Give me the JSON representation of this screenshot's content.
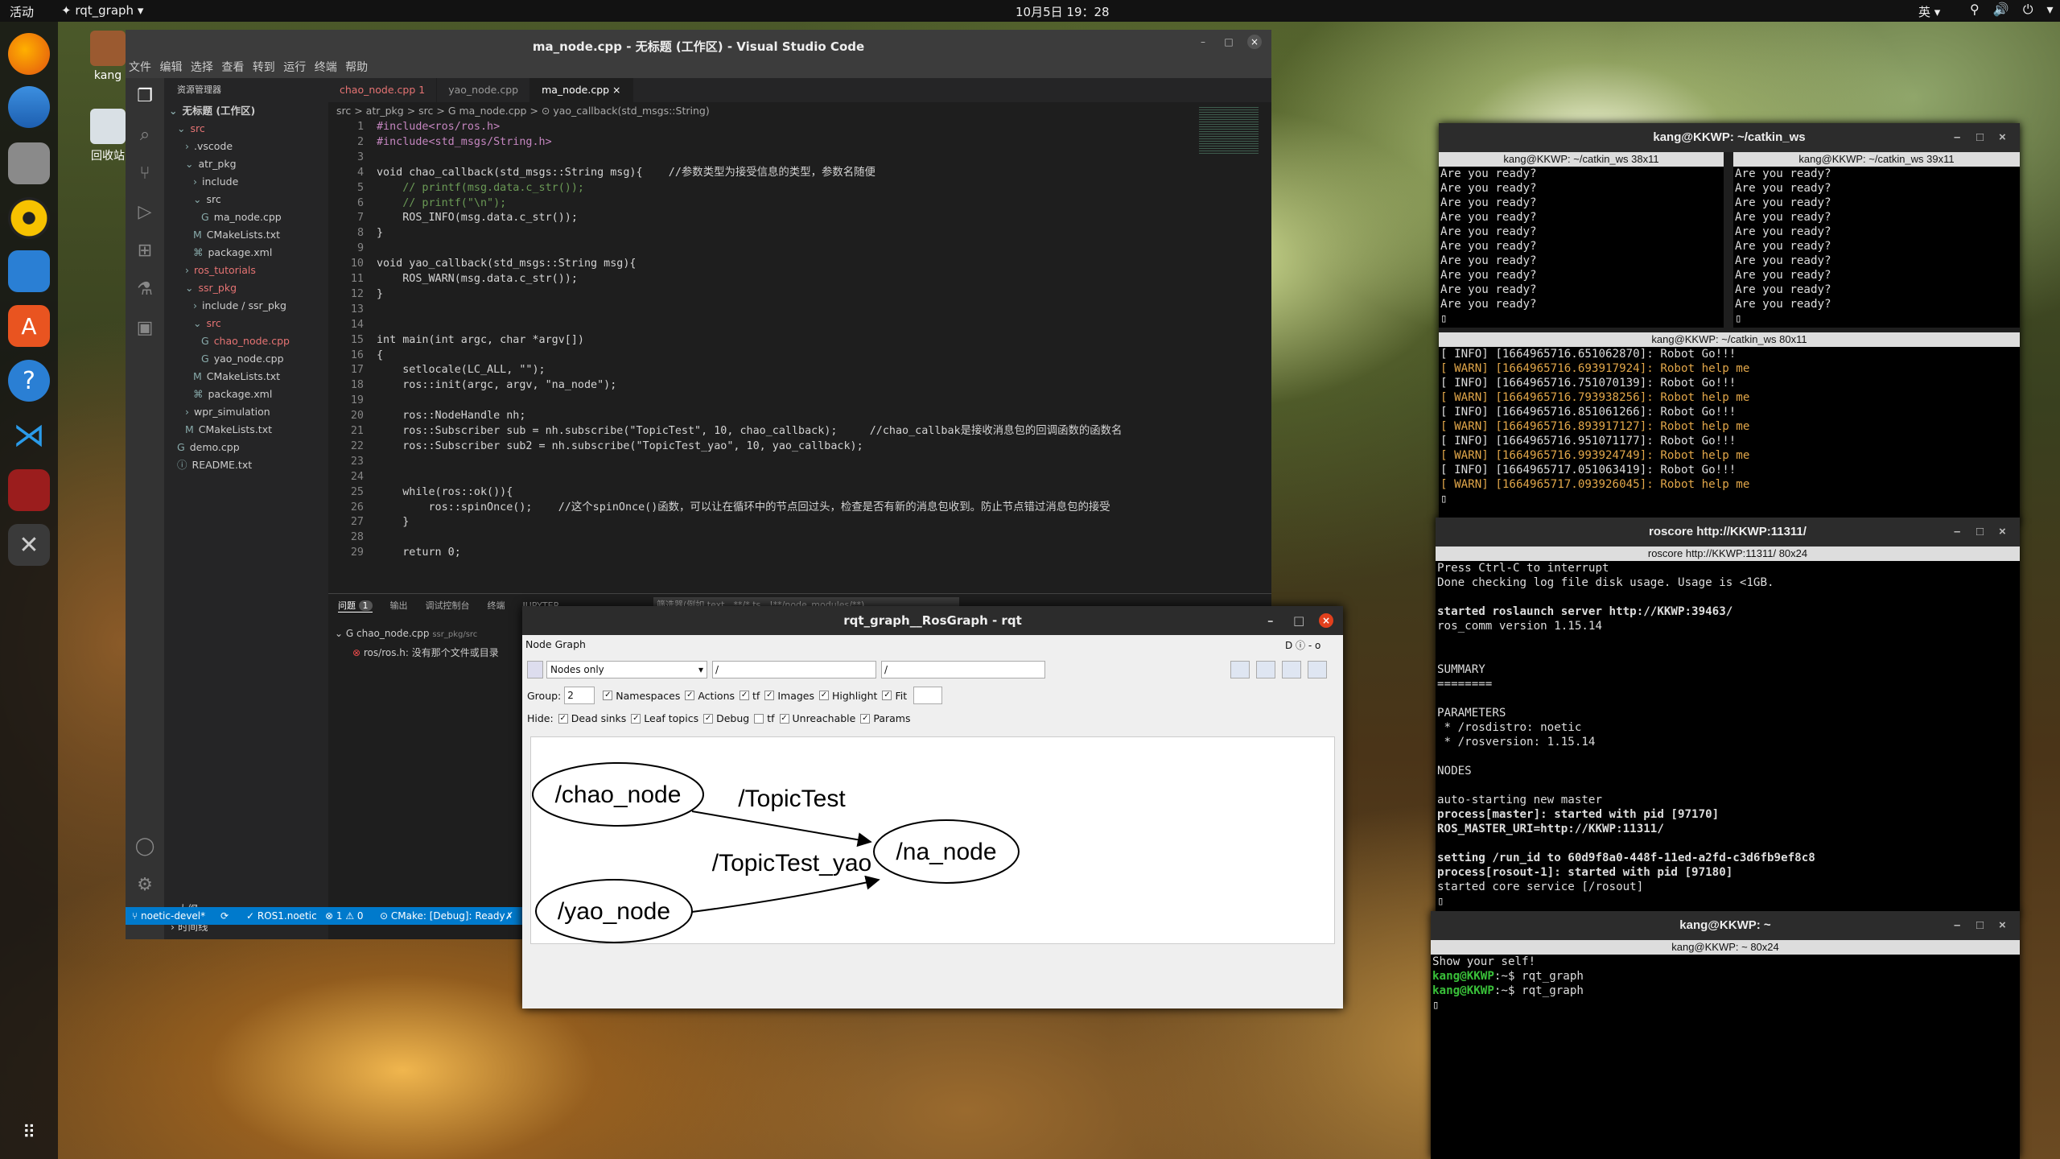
{
  "topbar": {
    "activities": "活动",
    "app": "✦ rqt_graph ▾",
    "clock": "10月5日  19：28",
    "ime": "英 ▾",
    "sys": "⚲ 🔊 ⏻ ▾"
  },
  "desktop": {
    "home_label": "kang",
    "trash_label": "回收站"
  },
  "vscode": {
    "title": "ma_node.cpp - 无标题 (工作区) - Visual Studio Code",
    "menu": [
      "文件",
      "编辑",
      "选择",
      "查看",
      "转到",
      "运行",
      "终端",
      "帮助"
    ],
    "explorer_title": "资源管理器",
    "tree": [
      {
        "label": "无标题 (工作区)",
        "indent": 0,
        "arrow": "⌄",
        "color": "#ccc",
        "bold": true
      },
      {
        "label": "src",
        "indent": 1,
        "arrow": "⌄",
        "color": "#e57373"
      },
      {
        "label": ".vscode",
        "indent": 2,
        "arrow": "›",
        "color": "#ccc"
      },
      {
        "label": "atr_pkg",
        "indent": 2,
        "arrow": "⌄",
        "color": "#ccc"
      },
      {
        "label": "include",
        "indent": 3,
        "arrow": "›",
        "color": "#ccc"
      },
      {
        "label": "src",
        "indent": 3,
        "arrow": "⌄",
        "color": "#ccc"
      },
      {
        "label": "ma_node.cpp",
        "indent": 4,
        "arrow": "G",
        "color": "#ccc"
      },
      {
        "label": "CMakeLists.txt",
        "indent": 3,
        "arrow": "M",
        "color": "#ccc"
      },
      {
        "label": "package.xml",
        "indent": 3,
        "arrow": "⌘",
        "color": "#ccc"
      },
      {
        "label": "ros_tutorials",
        "indent": 2,
        "arrow": "›",
        "color": "#e57373"
      },
      {
        "label": "ssr_pkg",
        "indent": 2,
        "arrow": "⌄",
        "color": "#e57373"
      },
      {
        "label": "include / ssr_pkg",
        "indent": 3,
        "arrow": "›",
        "color": "#ccc"
      },
      {
        "label": "src",
        "indent": 3,
        "arrow": "⌄",
        "color": "#e57373"
      },
      {
        "label": "chao_node.cpp",
        "indent": 4,
        "arrow": "G",
        "color": "#e57373"
      },
      {
        "label": "yao_node.cpp",
        "indent": 4,
        "arrow": "G",
        "color": "#ccc"
      },
      {
        "label": "CMakeLists.txt",
        "indent": 3,
        "arrow": "M",
        "color": "#ccc"
      },
      {
        "label": "package.xml",
        "indent": 3,
        "arrow": "⌘",
        "color": "#ccc"
      },
      {
        "label": "wpr_simulation",
        "indent": 2,
        "arrow": "›",
        "color": "#ccc"
      },
      {
        "label": "CMakeLists.txt",
        "indent": 2,
        "arrow": "M",
        "color": "#ccc"
      },
      {
        "label": "demo.cpp",
        "indent": 1,
        "arrow": "G",
        "color": "#ccc"
      },
      {
        "label": "README.txt",
        "indent": 1,
        "arrow": "ⓘ",
        "color": "#ccc"
      }
    ],
    "outline": "大纲",
    "timeline": "时间线",
    "tabs": [
      {
        "label": "chao_node.cpp 1",
        "active": false,
        "color": "#e57373"
      },
      {
        "label": "yao_node.cpp",
        "active": false,
        "color": "#999"
      },
      {
        "label": "ma_node.cpp  ×",
        "active": true,
        "color": "#fff"
      }
    ],
    "breadcrumb": "src > atr_pkg > src > G ma_node.cpp > ⊙ yao_callback(std_msgs::String)",
    "code": [
      "#include<ros/ros.h>",
      "#include<std_msgs/String.h>",
      "",
      "void chao_callback(std_msgs::String msg){    //参数类型为接受信息的类型，参数名随便",
      "    // printf(msg.data.c_str());",
      "    // printf(\"\\n\");",
      "    ROS_INFO(msg.data.c_str());",
      "}",
      "",
      "void yao_callback(std_msgs::String msg){",
      "    ROS_WARN(msg.data.c_str());",
      "}",
      "",
      "",
      "int main(int argc, char *argv[])",
      "{",
      "    setlocale(LC_ALL, \"\");",
      "    ros::init(argc, argv, \"na_node\");",
      "",
      "    ros::NodeHandle nh;",
      "    ros::Subscriber sub = nh.subscribe(\"TopicTest\", 10, chao_callback);     //chao_callbak是接收消息包的回调函数的函数名",
      "    ros::Subscriber sub2 = nh.subscribe(\"TopicTest_yao\", 10, yao_callback);",
      "",
      "",
      "    while(ros::ok()){",
      "        ros::spinOnce();    //这个spinOnce()函数，可以让在循环中的节点回过头，检查是否有新的消息包收到。防止节点错过消息包的接受",
      "    }",
      "",
      "    return 0;"
    ],
    "panel_tabs": [
      "问题",
      "输出",
      "调试控制台",
      "终端",
      "JUPYTER"
    ],
    "problem_count": "1",
    "filter_placeholder": "筛选器(例如 text、**/*.ts、!**/node_modules/**)",
    "problems": [
      {
        "file": "chao_node.cpp",
        "path": "ssr_pkg/src",
        "count": "1"
      },
      {
        "msg": "ros/ros.h: 没有那个文件或目录"
      }
    ],
    "status": {
      "branch": "noetic-devel*",
      "sync": "⟳",
      "ros": "✓ ROS1.noetic",
      "errors": "⊗ 1 ⚠ 0",
      "cmake": "⊙ CMake: [Debug]: Ready",
      "tools": "✗"
    }
  },
  "rqt": {
    "title": "rqt_graph__RosGraph - rqt",
    "plugin": "Node Graph",
    "mode": "Nodes only",
    "filter1": "/",
    "filter2": "/",
    "group_label": "Group:",
    "group_value": "2",
    "row1": [
      {
        "label": "Namespaces",
        "checked": true
      },
      {
        "label": "Actions",
        "checked": true
      },
      {
        "label": "tf",
        "checked": true
      },
      {
        "label": "Images",
        "checked": true
      },
      {
        "label": "Highlight",
        "checked": true
      },
      {
        "label": "Fit",
        "checked": true
      }
    ],
    "hide_label": "Hide:",
    "row2": [
      {
        "label": "Dead sinks",
        "checked": true
      },
      {
        "label": "Leaf topics",
        "checked": true
      },
      {
        "label": "Debug",
        "checked": true
      },
      {
        "label": "tf",
        "checked": false
      },
      {
        "label": "Unreachable",
        "checked": true
      },
      {
        "label": "Params",
        "checked": true
      }
    ],
    "graph": {
      "nodes": [
        "/chao_node",
        "/yao_node",
        "/na_node"
      ],
      "edges": [
        {
          "label": "/TopicTest",
          "from": "/chao_node",
          "to": "/na_node"
        },
        {
          "label": "/TopicTest_yao",
          "from": "/yao_node",
          "to": "/na_node"
        }
      ]
    }
  },
  "term1": {
    "title": "kang@KKWP: ~/catkin_ws",
    "pane_a": {
      "title": "kang@KKWP: ~/catkin_ws 38x11",
      "lines": [
        "Are you ready?",
        "Are you ready?",
        "Are you ready?",
        "Are you ready?",
        "Are you ready?",
        "Are you ready?",
        "Are you ready?",
        "Are you ready?",
        "Are you ready?",
        "Are you ready?"
      ]
    },
    "pane_b": {
      "title": "kang@KKWP: ~/catkin_ws 39x11",
      "lines": [
        "Are you ready?",
        "Are you ready?",
        "Are you ready?",
        "Are you ready?",
        "Are you ready?",
        "Are you ready?",
        "Are you ready?",
        "Are you ready?",
        "Are you ready?",
        "Are you ready?"
      ]
    },
    "pane_c": {
      "title": "kang@KKWP: ~/catkin_ws 80x11",
      "lines": [
        {
          "t": "[ INFO] [1664965716.651062870]: Robot Go!!!",
          "w": false
        },
        {
          "t": "[ WARN] [1664965716.693917924]: Robot help me",
          "w": true
        },
        {
          "t": "[ INFO] [1664965716.751070139]: Robot Go!!!",
          "w": false
        },
        {
          "t": "[ WARN] [1664965716.793938256]: Robot help me",
          "w": true
        },
        {
          "t": "[ INFO] [1664965716.851061266]: Robot Go!!!",
          "w": false
        },
        {
          "t": "[ WARN] [1664965716.893917127]: Robot help me",
          "w": true
        },
        {
          "t": "[ INFO] [1664965716.951071177]: Robot Go!!!",
          "w": false
        },
        {
          "t": "[ WARN] [1664965716.993924749]: Robot help me",
          "w": true
        },
        {
          "t": "[ INFO] [1664965717.051063419]: Robot Go!!!",
          "w": false
        },
        {
          "t": "[ WARN] [1664965717.093926045]: Robot help me",
          "w": true
        }
      ]
    }
  },
  "term2": {
    "title": "roscore http://KKWP:11311/",
    "pane_title": "roscore http://KKWP:11311/ 80x24",
    "lines": [
      {
        "t": "Press Ctrl-C to interrupt",
        "b": false
      },
      {
        "t": "Done checking log file disk usage. Usage is <1GB.",
        "b": false
      },
      {
        "t": "",
        "b": false
      },
      {
        "t": "started roslaunch server http://KKWP:39463/",
        "b": true
      },
      {
        "t": "ros_comm version 1.15.14",
        "b": false
      },
      {
        "t": "",
        "b": false
      },
      {
        "t": "",
        "b": false
      },
      {
        "t": "SUMMARY",
        "b": false
      },
      {
        "t": "========",
        "b": false
      },
      {
        "t": "",
        "b": false
      },
      {
        "t": "PARAMETERS",
        "b": false
      },
      {
        "t": " * /rosdistro: noetic",
        "b": false
      },
      {
        "t": " * /rosversion: 1.15.14",
        "b": false
      },
      {
        "t": "",
        "b": false
      },
      {
        "t": "NODES",
        "b": false
      },
      {
        "t": "",
        "b": false
      },
      {
        "t": "auto-starting new master",
        "b": false
      },
      {
        "t": "process[master]: started with pid [97170]",
        "b": true
      },
      {
        "t": "ROS_MASTER_URI=http://KKWP:11311/",
        "b": true
      },
      {
        "t": "",
        "b": false
      },
      {
        "t": "setting /run_id to 60d9f8a0-448f-11ed-a2fd-c3d6fb9ef8c8",
        "b": true
      },
      {
        "t": "process[rosout-1]: started with pid [97180]",
        "b": true
      },
      {
        "t": "started core service [/rosout]",
        "b": false
      }
    ]
  },
  "term3": {
    "title": "kang@KKWP: ~",
    "pane_title": "kang@KKWP: ~ 80x24",
    "line0": "Show your self!",
    "prompt": "kang@KKWP",
    "suffix": ":~$ ",
    "cmd1": "rqt_graph",
    "cmd2": "rqt_graph"
  },
  "colors": {
    "vscode_status": "#007acc",
    "warn": "#e2a74a",
    "prompt": "#39c039"
  }
}
